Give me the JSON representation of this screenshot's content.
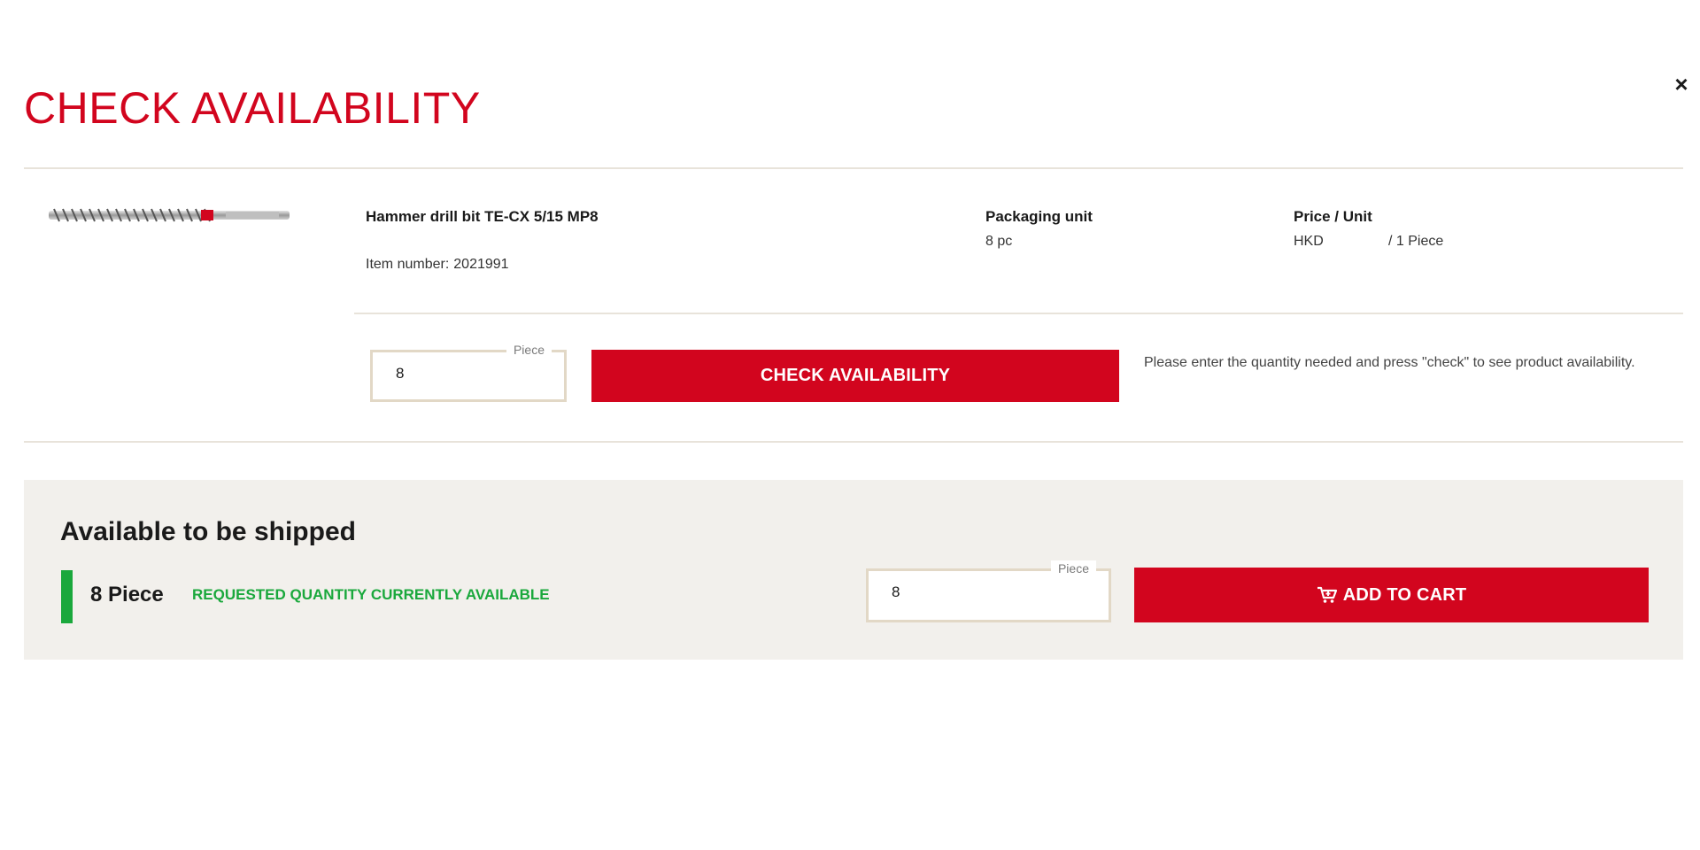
{
  "modal": {
    "title": "CHECK AVAILABILITY",
    "close_symbol": "×"
  },
  "product": {
    "image_icon": "drill-bit-image",
    "name": "Hammer drill bit TE-CX 5/15 MP8",
    "item_number_label": "Item number:",
    "item_number": "2021991",
    "packaging_label": "Packaging unit",
    "packaging_value": "8 pc",
    "price_label": "Price / Unit",
    "price_currency": "HKD",
    "price_unit": "/ 1 Piece"
  },
  "quantity_check": {
    "legend": "Piece",
    "value": "8",
    "button_label": "CHECK AVAILABILITY",
    "help_text": "Please enter the quantity needed and press \"check\" to see product availability."
  },
  "availability": {
    "heading": "Available to be shipped",
    "quantity": "8 Piece",
    "status": "REQUESTED QUANTITY CURRENTLY AVAILABLE",
    "status_color": "#1aa83c",
    "qty_legend": "Piece",
    "qty_value": "8",
    "cart_icon": "cart-icon",
    "add_button_label": "ADD TO CART"
  },
  "colors": {
    "accent": "#d2051e",
    "panel_bg": "#f2f0ec",
    "input_border": "#e2d8c6"
  }
}
